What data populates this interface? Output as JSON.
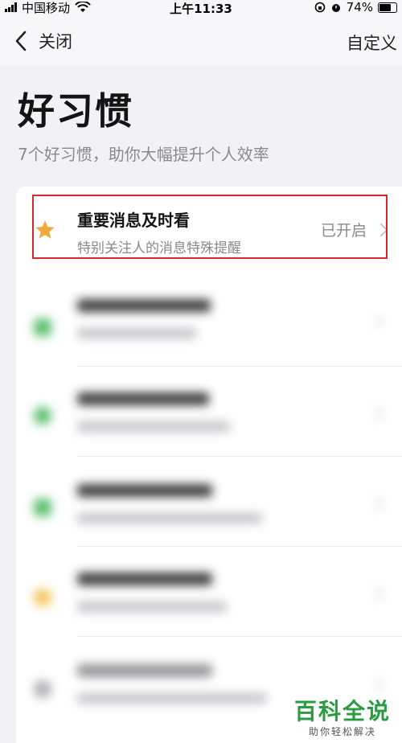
{
  "status_bar": {
    "carrier": "中国移动",
    "time": "上午11:33",
    "battery": "74%"
  },
  "nav": {
    "back_label": "关闭",
    "right_label": "自定义"
  },
  "page": {
    "title": "好习惯",
    "subtitle": "7个好习惯，助你大幅提升个人效率"
  },
  "highlight_item": {
    "title": "重要消息及时看",
    "desc": "特别关注人的消息特殊提醒",
    "status": "已开启",
    "icon": "star-icon",
    "icon_color": "#f2a93b",
    "outline_color": "#d9262b"
  },
  "blurred_items": [
    {
      "icon": "mail-icon",
      "color": "#4cb85c"
    },
    {
      "icon": "phone-icon",
      "color": "#4cb85c"
    },
    {
      "icon": "calendar-icon",
      "color": "#4cb85c"
    },
    {
      "icon": "star-icon",
      "color": "#f2c14a"
    },
    {
      "icon": "clock-icon",
      "color": "#a8a8ad"
    }
  ],
  "watermark": {
    "main": "百科全说",
    "sub": "助你轻松解决"
  }
}
